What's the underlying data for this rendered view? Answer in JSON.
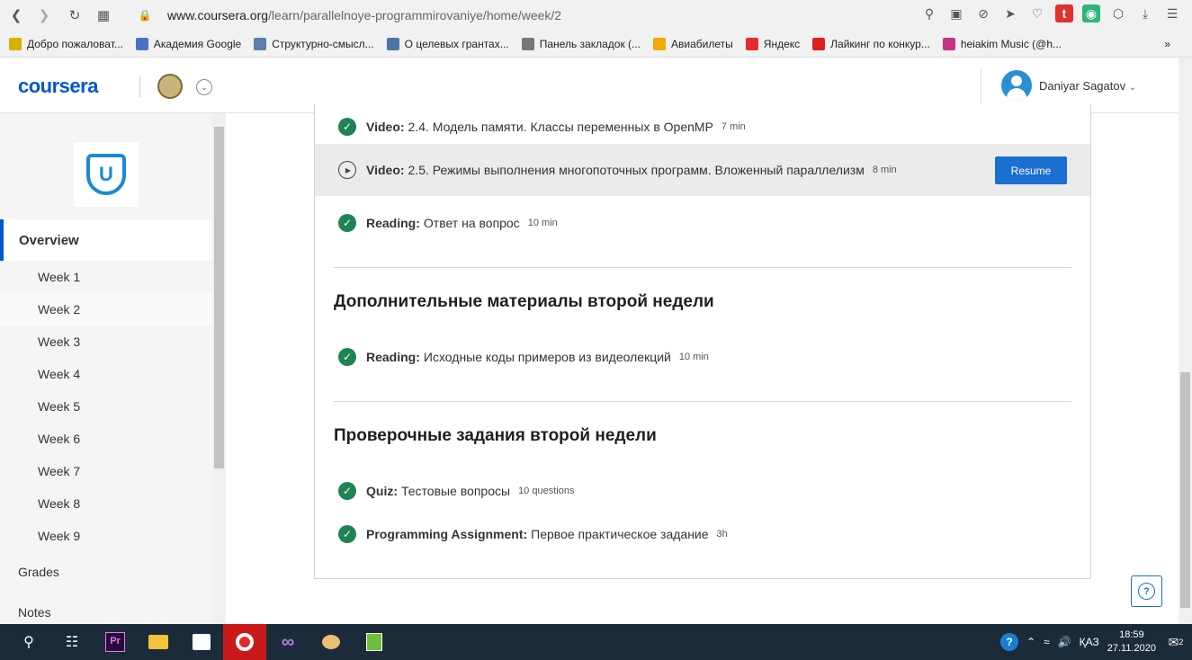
{
  "browser": {
    "url_host": "www.coursera.org",
    "url_path": "/learn/parallelnoye-programmirovaniye/home/week/2",
    "bookmarks": [
      {
        "label": "Добро пожаловат...",
        "color": "#d4b000"
      },
      {
        "label": "Академия Google",
        "color": "#4a70c8"
      },
      {
        "label": "Структурно-смысл...",
        "color": "#5b7fa8"
      },
      {
        "label": "О целевых грантах...",
        "color": "#4c75a3"
      },
      {
        "label": "Панель закладок (...",
        "color": "#777777"
      },
      {
        "label": "Авиабилеты",
        "color": "#f2a900"
      },
      {
        "label": "Яндекс",
        "color": "#e32b2b"
      },
      {
        "label": "Лайкинг по конкур...",
        "color": "#e01e1e"
      },
      {
        "label": "heiakim Music (@h...",
        "color": "#c13584"
      }
    ]
  },
  "header": {
    "logo": "coursera",
    "username": "Daniyar Sagatov"
  },
  "sidebar": {
    "overview": "Overview",
    "weeks": [
      "Week 1",
      "Week 2",
      "Week 3",
      "Week 4",
      "Week 5",
      "Week 6",
      "Week 7",
      "Week 8",
      "Week 9"
    ],
    "grades": "Grades",
    "notes": "Notes",
    "course_logo_letter": "U"
  },
  "content": {
    "items": [
      {
        "type": "Video:",
        "title": "2.4. Модель памяти. Классы переменных в OpenMP",
        "duration": "7 min"
      },
      {
        "type": "Video:",
        "title": "2.5. Режимы выполнения многопоточных программ. Вложенный параллелизм",
        "duration": "8 min",
        "button": "Resume"
      },
      {
        "type": "Reading:",
        "title": "Ответ на вопрос",
        "duration": "10 min"
      }
    ],
    "section2": {
      "title": "Дополнительные материалы второй недели",
      "items": [
        {
          "type": "Reading:",
          "title": "Исходные коды примеров из видеолекций",
          "duration": "10 min"
        }
      ]
    },
    "section3": {
      "title": "Проверочные задания второй недели",
      "items": [
        {
          "type": "Quiz:",
          "title": "Тестовые вопросы",
          "duration": "10 questions"
        },
        {
          "type": "Programming Assignment:",
          "title": "Первое практическое задание",
          "duration": "3h"
        }
      ]
    },
    "help": "?"
  },
  "taskbar": {
    "lang": "ҚАЗ",
    "time": "18:59",
    "date": "27.11.2020",
    "notif_count": "2"
  }
}
